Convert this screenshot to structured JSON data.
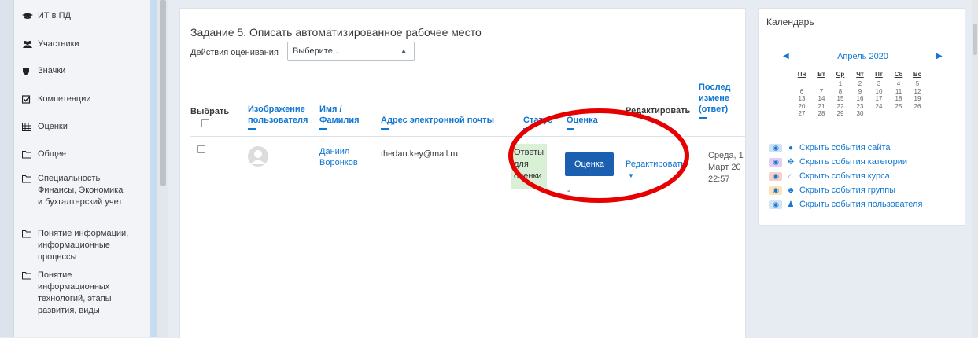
{
  "sidebar": {
    "items": [
      {
        "label": "ИТ в ПД",
        "icon": "graduation-cap-icon"
      },
      {
        "label": "Участники",
        "icon": "users-icon"
      },
      {
        "label": "Значки",
        "icon": "shield-icon"
      },
      {
        "label": "Компетенции",
        "icon": "checkbox-icon"
      },
      {
        "label": "Оценки",
        "icon": "table-icon"
      },
      {
        "label": "Общее",
        "icon": "folder-icon"
      },
      {
        "label": "Специальность\nФинансы, Экономика\nи бухгалтерский учет",
        "icon": "folder-icon"
      },
      {
        "label": "Понятие информации,\nинформационные\nпроцессы",
        "icon": "folder-icon"
      },
      {
        "label": "Понятие\nинформационных\nтехнологий, этапы\nразвития, виды",
        "icon": "folder-icon"
      }
    ]
  },
  "main": {
    "title": "Задание 5. Описать автоматизированное рабочее место",
    "grading_actions_label": "Действия оценивания",
    "grading_select_value": "Выберите...",
    "columns": {
      "select": "Выбрать",
      "user_picture": "Изображение\nпользователя",
      "name": "Имя /\nФамилия",
      "email": "Адрес электронной почты",
      "status": "Статус",
      "grade": "Оценка",
      "edit": "Редактировать",
      "last_modified": "Послед\nизмене\n(ответ)"
    },
    "row": {
      "name": "Даниил\nВоронков",
      "email": "thedan.key@mail.ru",
      "status": "Ответы\nдля\nоценки",
      "grade_button": "Оценка",
      "grade_value": "-",
      "edit_link": "Редактировать",
      "last_modified": "Среда, 1\nМарт 20\n22:57"
    }
  },
  "calendar": {
    "title": "Календарь",
    "month": "Апрель 2020",
    "weekdays": [
      "Пн",
      "Вт",
      "Ср",
      "Чт",
      "Пт",
      "Сб",
      "Вс"
    ],
    "weeks": [
      [
        "",
        "",
        "1",
        "2",
        "3",
        "4",
        "5"
      ],
      [
        "6",
        "7",
        "8",
        "9",
        "10",
        "11",
        "12"
      ],
      [
        "13",
        "14",
        "15",
        "16",
        "17",
        "18",
        "19"
      ],
      [
        "20",
        "21",
        "22",
        "23",
        "24",
        "25",
        "26"
      ],
      [
        "27",
        "28",
        "29",
        "30",
        "",
        "",
        ""
      ]
    ],
    "events": [
      {
        "label": "Скрыть события сайта",
        "eye_bg": "#cfe3f7",
        "icon": "globe-icon",
        "glyph": "●"
      },
      {
        "label": "Скрыть события категории",
        "eye_bg": "#e3cdf2",
        "icon": "cubes-icon",
        "glyph": "✥"
      },
      {
        "label": "Скрыть события курса",
        "eye_bg": "#f7d0c8",
        "icon": "university-icon",
        "glyph": "⌂"
      },
      {
        "label": "Скрыть события группы",
        "eye_bg": "#fde3b8",
        "icon": "group-icon",
        "glyph": "☻"
      },
      {
        "label": "Скрыть события пользователя",
        "eye_bg": "#d3e5f4",
        "icon": "user-icon",
        "glyph": "♟"
      }
    ]
  },
  "colors": {
    "link": "#1177d1",
    "grade_button": "#1a5fb0",
    "status_bg": "#d9efd6",
    "annotation_circle": "#e60000"
  }
}
